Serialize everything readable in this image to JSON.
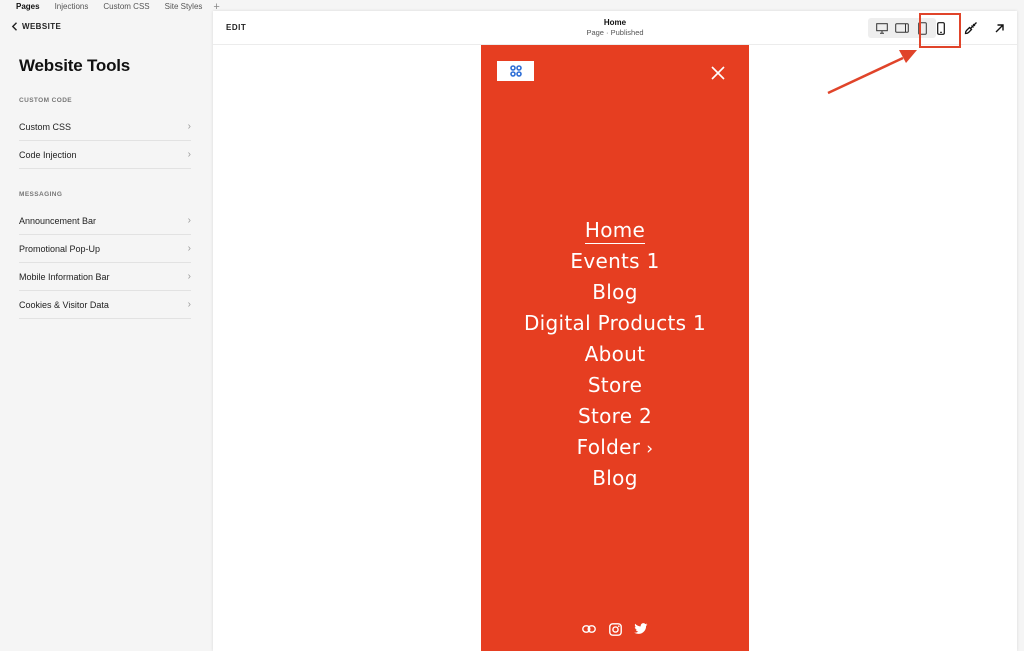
{
  "tabs": [
    "Pages",
    "Injections",
    "Custom CSS",
    "Site Styles"
  ],
  "tab_add": "+",
  "sidebar": {
    "back_label": "WEBSITE",
    "title": "Website Tools",
    "sections": [
      {
        "label": "CUSTOM CODE",
        "items": [
          "Custom CSS",
          "Code Injection"
        ]
      },
      {
        "label": "MESSAGING",
        "items": [
          "Announcement Bar",
          "Promotional Pop-Up",
          "Mobile Information Bar",
          "Cookies & Visitor Data"
        ]
      }
    ]
  },
  "editor": {
    "edit_label": "EDIT",
    "page_title": "Home",
    "page_status": "Page · Published",
    "annotation_color": "#e0442a"
  },
  "preview": {
    "background": "#e63e21",
    "nav": [
      "Home",
      "Events 1",
      "Blog",
      "Digital Products 1",
      "About",
      "Store",
      "Store 2",
      "Folder",
      "Blog"
    ],
    "current_nav": "Home",
    "folder_chevron": "›",
    "social_icons": [
      "link-icon",
      "instagram-icon",
      "twitter-icon"
    ]
  }
}
